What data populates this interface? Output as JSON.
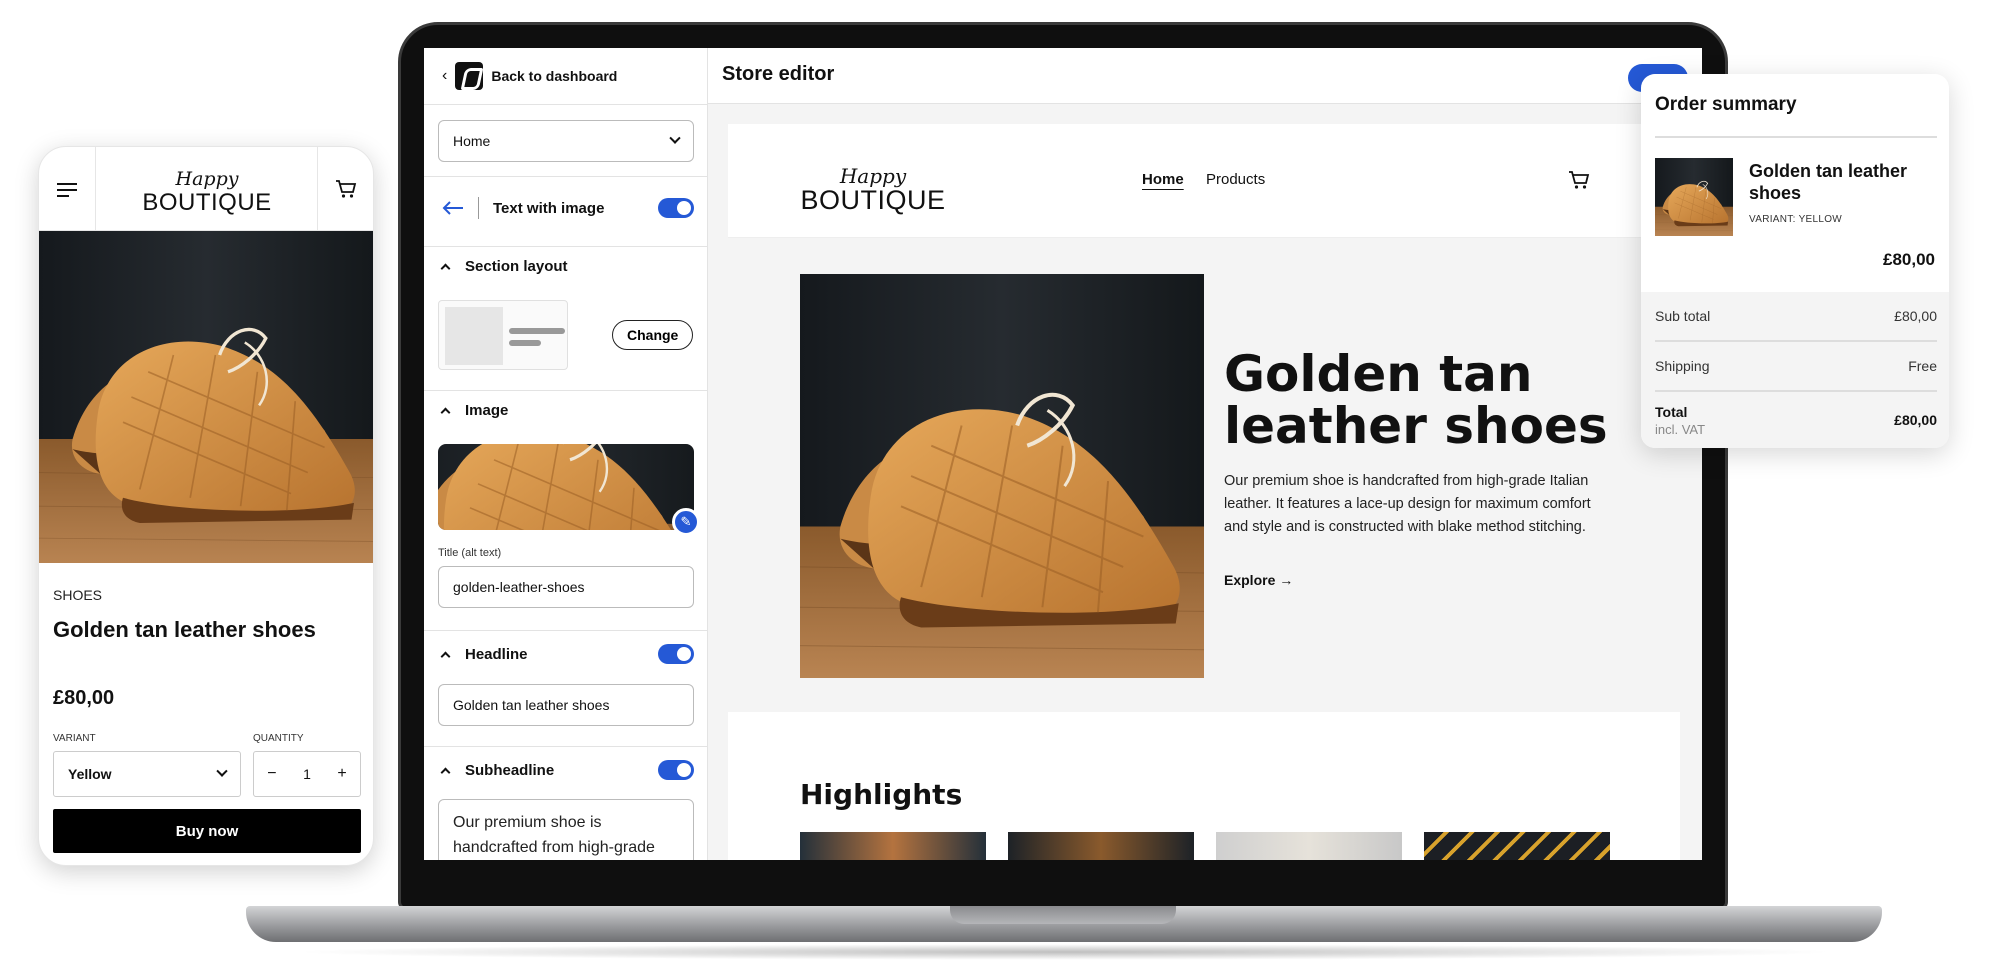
{
  "editor": {
    "back_label": "Back to dashboard",
    "page_select": "Home",
    "section_name": "Text with image",
    "topbar_title": "Store editor",
    "sections": {
      "layout": {
        "title": "Section layout",
        "change_label": "Change"
      },
      "image": {
        "title": "Image",
        "alt_label": "Title (alt text)",
        "alt_value": "golden-leather-shoes"
      },
      "headline": {
        "title": "Headline",
        "value": "Golden tan leather shoes"
      },
      "subheadline": {
        "title": "Subheadline",
        "value": "Our premium shoe is handcrafted from high-grade"
      }
    },
    "accent_color": "#2559d6"
  },
  "store_preview": {
    "brand_script": "Happy",
    "brand_main": "BOUTIQUE",
    "nav": [
      "Home",
      "Products"
    ],
    "hero": {
      "title": "Golden tan leather shoes",
      "body": "Our premium shoe is handcrafted from high-grade Italian leather. It features a lace-up design for maximum comfort and style and is constructed with blake method stitching.",
      "link": "Explore"
    },
    "highlights_title": "Highlights"
  },
  "phone": {
    "brand_script": "Happy",
    "brand_main": "BOUTIQUE",
    "category": "SHOES",
    "title": "Golden tan leather shoes",
    "price": "£80,00",
    "variant_label": "VARIANT",
    "variant_value": "Yellow",
    "quantity_label": "QUANTITY",
    "quantity_value": "1",
    "minus": "−",
    "plus": "+",
    "buy_label": "Buy now"
  },
  "order_summary": {
    "title": "Order summary",
    "item_name": "Golden tan leather shoes",
    "item_variant": "VARIANT: YELLOW",
    "item_price": "£80,00",
    "subtotal_label": "Sub total",
    "subtotal_value": "£80,00",
    "shipping_label": "Shipping",
    "shipping_value": "Free",
    "total_label": "Total",
    "total_value": "£80,00",
    "vat_note": "incl. VAT"
  }
}
